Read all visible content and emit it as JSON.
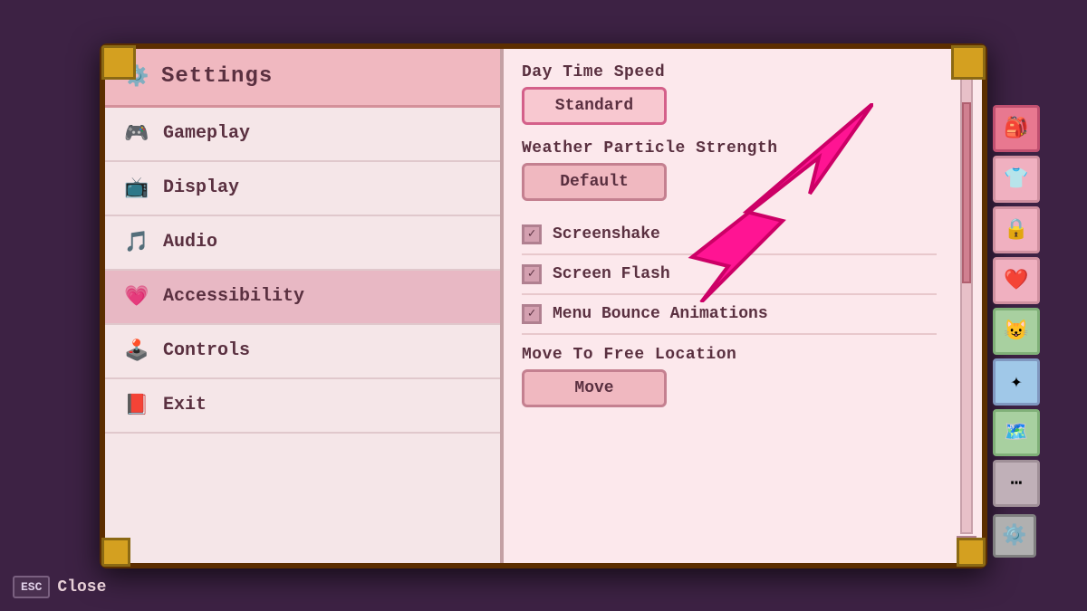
{
  "header": {
    "title": "Settings",
    "gear_icon": "⚙"
  },
  "sidebar": {
    "items": [
      {
        "id": "gameplay",
        "label": "Gameplay",
        "icon": "🎮",
        "active": false
      },
      {
        "id": "display",
        "label": "Display",
        "icon": "📺",
        "active": false
      },
      {
        "id": "audio",
        "label": "Audio",
        "icon": "🎵",
        "active": false
      },
      {
        "id": "accessibility",
        "label": "Accessibility",
        "icon": "💗",
        "active": true
      },
      {
        "id": "controls",
        "label": "Controls",
        "icon": "🕹",
        "active": false
      },
      {
        "id": "exit",
        "label": "Exit",
        "icon": "📕",
        "active": false
      }
    ]
  },
  "content": {
    "settings": [
      {
        "id": "day-time-speed",
        "label": "Day Time Speed",
        "type": "button",
        "value": "Standard",
        "highlighted": true
      },
      {
        "id": "weather-particle-strength",
        "label": "Weather Particle Strength",
        "type": "button",
        "value": "Default",
        "highlighted": false
      },
      {
        "id": "screenshake",
        "label": "Screenshake",
        "type": "checkbox",
        "checked": true
      },
      {
        "id": "screen-flash",
        "label": "Screen Flash",
        "type": "checkbox",
        "checked": true
      },
      {
        "id": "menu-bounce-animations",
        "label": "Menu Bounce Animations",
        "type": "checkbox",
        "checked": true
      },
      {
        "id": "move-to-free-location",
        "label": "Move To Free Location",
        "type": "button",
        "value": "Move",
        "highlighted": false
      }
    ]
  },
  "side_icons": [
    {
      "id": "backpack",
      "icon": "🎒",
      "style": "pink-bg"
    },
    {
      "id": "shirt",
      "icon": "👕",
      "style": "light-pink"
    },
    {
      "id": "lock",
      "icon": "🔒",
      "style": "light-pink"
    },
    {
      "id": "heart",
      "icon": "❤️",
      "style": "light-pink"
    },
    {
      "id": "face",
      "icon": "😺",
      "style": "green-bg"
    },
    {
      "id": "star",
      "icon": "✦",
      "style": "blue-bg"
    },
    {
      "id": "map",
      "icon": "🗺",
      "style": "green-bg"
    },
    {
      "id": "more",
      "icon": "⋯",
      "style": "gray-bg"
    }
  ],
  "footer": {
    "esc_label": "ESC",
    "close_label": "Close"
  }
}
